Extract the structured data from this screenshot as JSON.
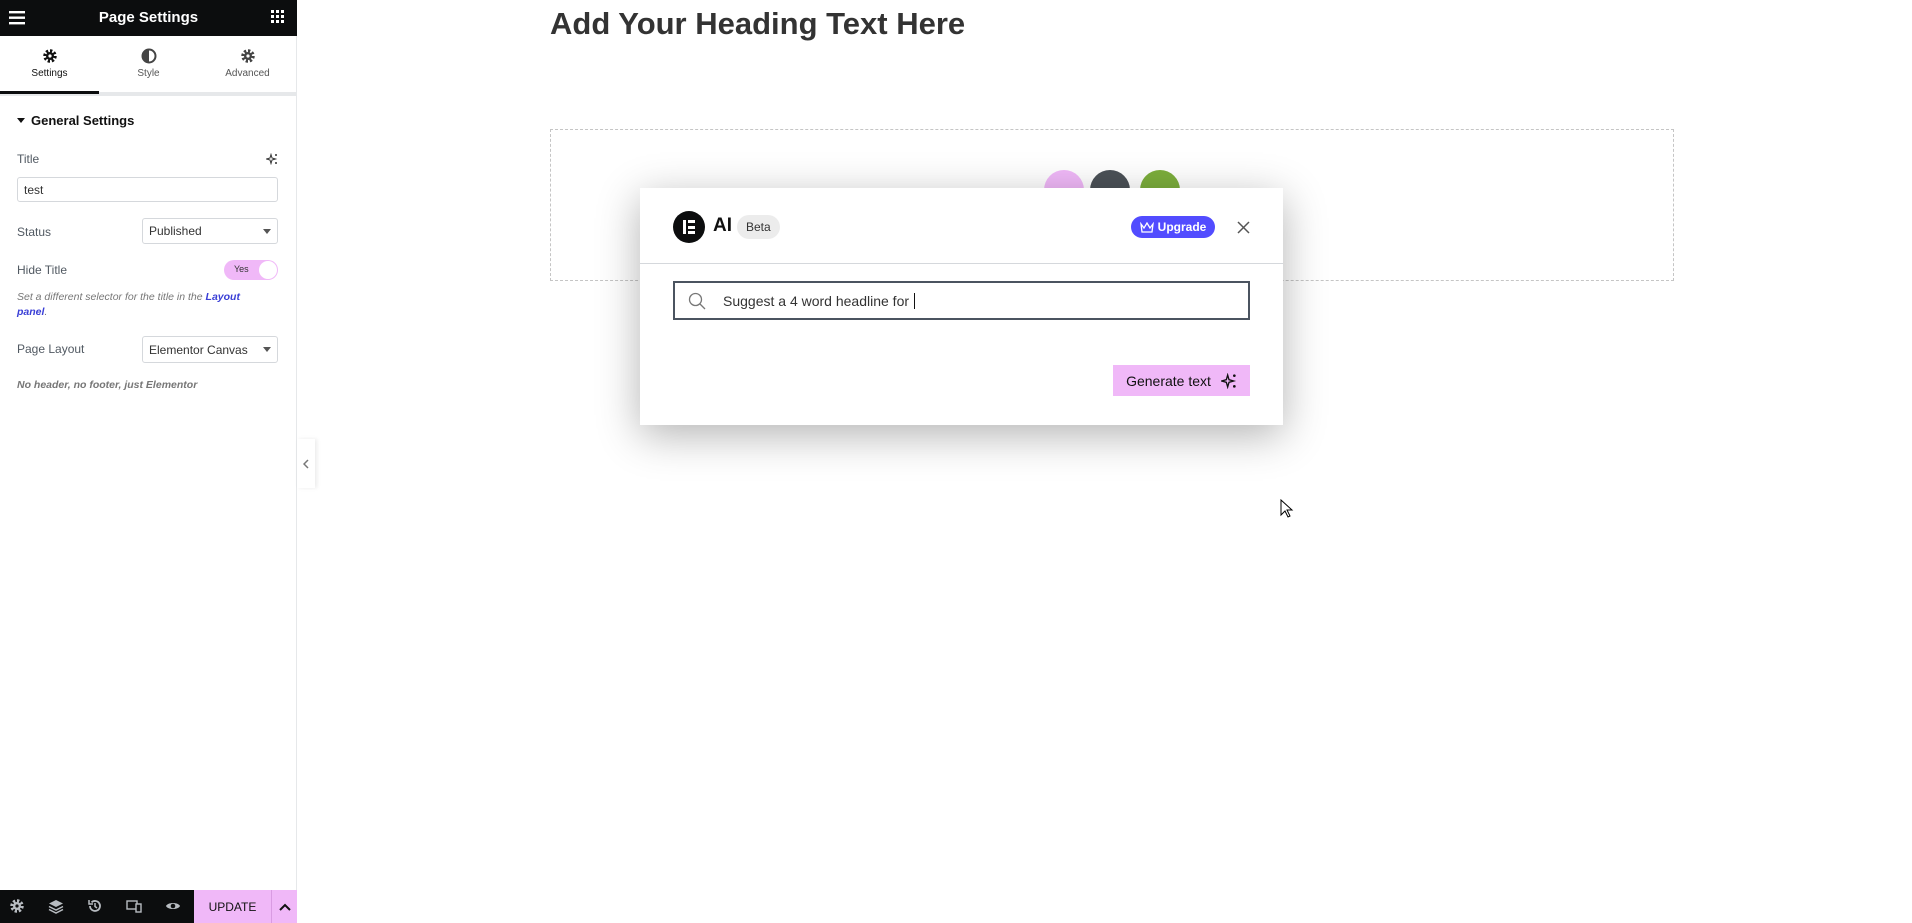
{
  "panel": {
    "title": "Page Settings",
    "tabs": [
      {
        "label": "Settings",
        "icon": "gear-icon"
      },
      {
        "label": "Style",
        "icon": "contrast-icon"
      },
      {
        "label": "Advanced",
        "icon": "gear-icon"
      }
    ],
    "section": "General Settings",
    "title_label": "Title",
    "title_value": "test",
    "status_label": "Status",
    "status_value": "Published",
    "hide_title_label": "Hide Title",
    "hide_title_value": "Yes",
    "hide_help": "Set a different selector for the title in the ",
    "hide_help_link": "Layout panel",
    "hide_help_end": ".",
    "layout_label": "Page Layout",
    "layout_value": "Elementor Canvas",
    "layout_note": "No header, no footer, just Elementor",
    "update_label": "UPDATE"
  },
  "canvas": {
    "heading": "Add Your Heading Text Here"
  },
  "modal": {
    "title": "AI",
    "badge": "Beta",
    "upgrade_label": "Upgrade",
    "prompt_value": "Suggest a 4 word headline for ",
    "generate_label": "Generate text"
  },
  "colors": {
    "accent": "#f0b8f8",
    "upgrade": "#524cff",
    "dark": "#0c0d0e"
  }
}
